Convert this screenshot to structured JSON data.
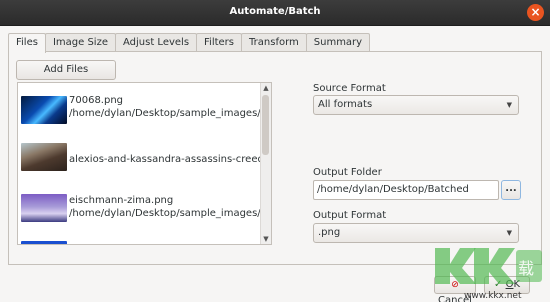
{
  "window": {
    "title": "Automate/Batch"
  },
  "tabs": [
    {
      "label": "Files"
    },
    {
      "label": "Image Size"
    },
    {
      "label": "Adjust Levels"
    },
    {
      "label": "Filters"
    },
    {
      "label": "Transform"
    },
    {
      "label": "Summary"
    }
  ],
  "files": {
    "add_label": "Add Files",
    "items": [
      {
        "name": "70068.png",
        "path": "/home/dylan/Desktop/sample_images/..."
      },
      {
        "name": "alexios-and-kassandra-assassins-creed...",
        "path": ""
      },
      {
        "name": "eischmann-zima.png",
        "path": "/home/dylan/Desktop/sample_images/..."
      }
    ]
  },
  "source_format": {
    "label": "Source Format",
    "value": "All formats"
  },
  "output_folder": {
    "label": "Output Folder",
    "value": "/home/dylan/Desktop/Batched",
    "browse_label": "..."
  },
  "output_format": {
    "label": "Output Format",
    "value": ".png"
  },
  "buttons": {
    "cancel_mnemonic": "C",
    "cancel_rest": "ancel",
    "ok_mnemonic": "O",
    "ok_rest": "K"
  },
  "watermark": {
    "text": "KK下载",
    "url": "www.kkx.net"
  },
  "colors": {
    "titlebar": "#2b2b2b",
    "close": "#e95420",
    "accent": "#8fb7e0"
  }
}
